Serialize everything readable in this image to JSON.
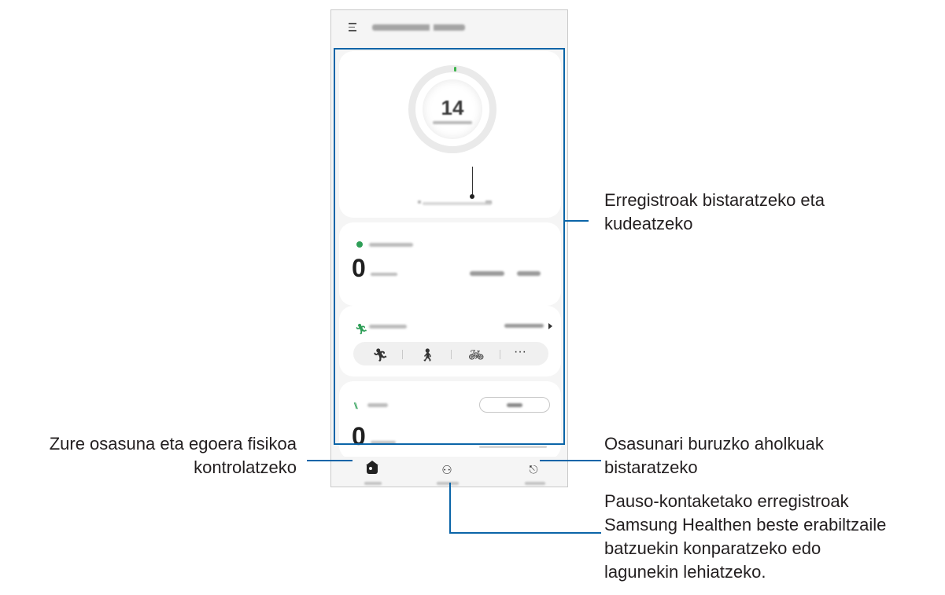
{
  "phone": {
    "app_title": "SAMSUNG Health",
    "steps_card": {
      "count": "14"
    },
    "active_card": {
      "value": "0"
    },
    "exercise_card": {
      "activity_icons": [
        "running-icon",
        "walking-icon",
        "cycling-icon",
        "more-icon"
      ],
      "more_label": "···"
    },
    "food_card": {
      "value": "0"
    },
    "bottom_nav": [
      {
        "icon": "home-icon"
      },
      {
        "icon": "together-icon"
      },
      {
        "icon": "discover-icon"
      }
    ]
  },
  "callouts": {
    "records": [
      "Erregistroak bistaratzeko eta",
      "kudeatzeko"
    ],
    "home": [
      "Zure osasuna eta egoera fisikoa",
      "kontrolatzeko"
    ],
    "discover": [
      "Osasunari buruzko aholkuak",
      "bistaratzeko"
    ],
    "together": [
      "Pauso-kontaketako erregistroak",
      "Samsung Healthen beste erabiltzaile",
      "batzuekin konparatzeko edo",
      "lagunekin lehiatzeko."
    ]
  },
  "colors": {
    "callout_line": "#0b65a8",
    "accent_green": "#2e9e57"
  }
}
